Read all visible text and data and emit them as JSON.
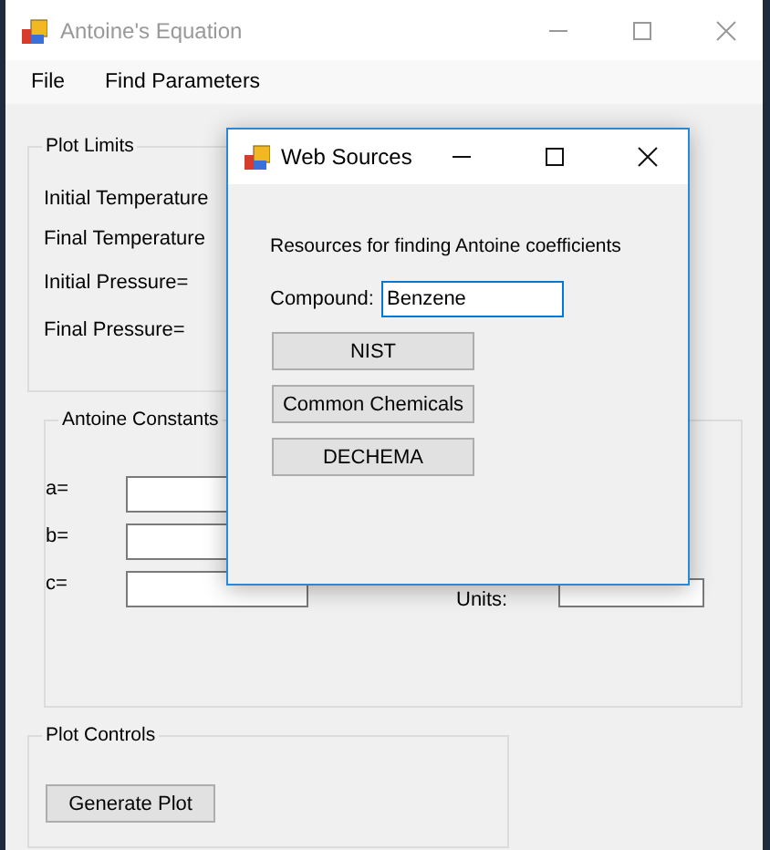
{
  "window": {
    "title": "Antoine's Equation"
  },
  "menu": [
    "File",
    "Find Parameters"
  ],
  "plot_limits": {
    "title": "Plot Limits",
    "labels": [
      "Initial Temperature",
      "Final Temperature",
      "Initial Pressure=",
      "Final Pressure="
    ]
  },
  "antoine_constants": {
    "title": "Antoine Constants",
    "fields": [
      {
        "label": "a="
      },
      {
        "label": "b="
      },
      {
        "label": "c="
      }
    ],
    "units_label": "Units:"
  },
  "plot_controls": {
    "title": "Plot Controls",
    "button": "Generate Plot"
  },
  "dialog": {
    "title": "Web Sources",
    "description": "Resources for finding Antoine coefficients",
    "compound": {
      "label": "Compound:",
      "value": "Benzene"
    },
    "buttons": [
      "NIST",
      "Common Chemicals",
      "DECHEMA"
    ]
  }
}
